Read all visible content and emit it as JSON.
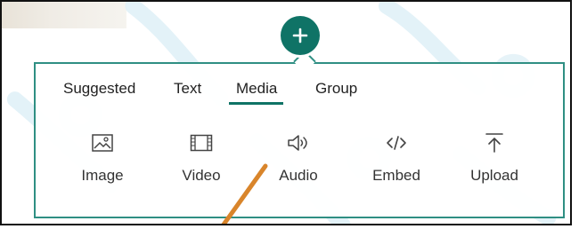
{
  "tabs": {
    "suggested": "Suggested",
    "text": "Text",
    "media": "Media",
    "group": "Group"
  },
  "items": {
    "image": "Image",
    "video": "Video",
    "audio": "Audio",
    "embed": "Embed",
    "upload": "Upload"
  },
  "icons": {
    "add": "plus-icon",
    "image": "image-icon",
    "video": "film-icon",
    "audio": "speaker-icon",
    "embed": "code-icon",
    "upload": "upload-icon"
  },
  "colors": {
    "accent": "#0f7366",
    "panel_border": "#2f8f83",
    "annotation": "#d9852b"
  }
}
